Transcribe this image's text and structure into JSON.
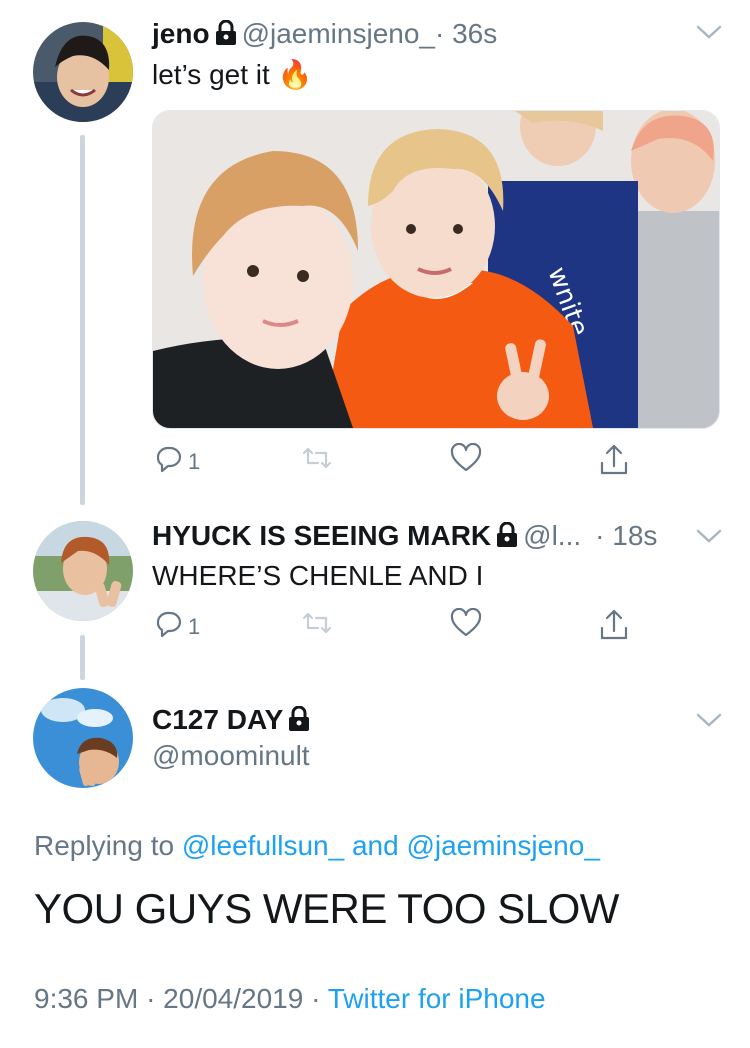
{
  "tweets": [
    {
      "name": "jeno",
      "handle": "@jaeminsjeno_",
      "time": "· 36s",
      "text": "let’s get it",
      "emoji": "🔥",
      "reply_count": "1"
    },
    {
      "name": "HYUCK IS SEEING MARK",
      "handle": "@l...",
      "time": "· 18s",
      "text": "WHERE’S CHENLE AND I",
      "reply_count": "1"
    }
  ],
  "main_tweet": {
    "name": "C127 DAY",
    "handle": "@moominult",
    "replying_prefix": "Replying to",
    "replying_user1": "@leefullsun_",
    "replying_and": "and",
    "replying_user2": "@jaeminsjeno_",
    "text": "YOU GUYS WERE TOO SLOW",
    "time": "9:36 PM",
    "date": "20/04/2019",
    "source": "Twitter for iPhone",
    "sep": "·"
  },
  "colors": {
    "link": "#1da1f2",
    "muted": "#657786",
    "line": "#ccd6dd"
  },
  "icons": [
    "lock-icon",
    "chevron-down-icon",
    "reply-icon",
    "retweet-icon",
    "like-icon",
    "share-icon",
    "fire-emoji"
  ]
}
